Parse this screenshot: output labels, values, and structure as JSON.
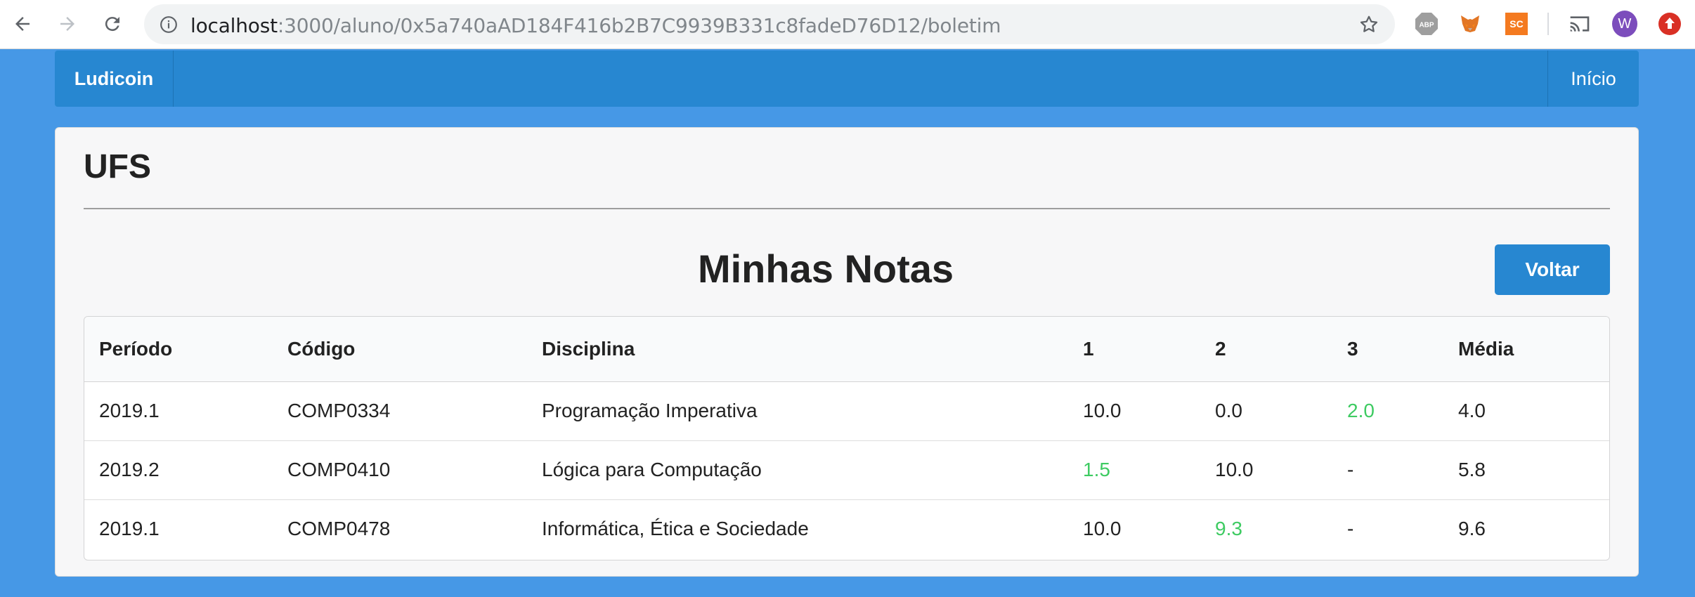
{
  "browser": {
    "url_host": "localhost",
    "url_rest": ":3000/aluno/0x5a740aAD184F416b2B7C9939B331c8fadeD76D12/boletim",
    "extensions": [
      {
        "name": "adblock",
        "label": "ABP"
      },
      {
        "name": "metamask",
        "label": ""
      },
      {
        "name": "sc",
        "label": "SC"
      },
      {
        "name": "cast",
        "label": ""
      },
      {
        "name": "profile",
        "label": "W"
      },
      {
        "name": "update",
        "label": ""
      }
    ]
  },
  "navbar": {
    "brand": "Ludicoin",
    "link": "Início"
  },
  "card": {
    "title": "UFS",
    "section_title": "Minhas Notas",
    "back_button": "Voltar"
  },
  "table": {
    "headers": [
      "Período",
      "Código",
      "Disciplina",
      "1",
      "2",
      "3",
      "Média"
    ],
    "rows": [
      {
        "periodo": "2019.1",
        "codigo": "COMP0334",
        "disciplina": "Programação Imperativa",
        "n1": "10.0",
        "n2": "0.0",
        "n3": "2.0",
        "media": "4.0",
        "highlight": "n3"
      },
      {
        "periodo": "2019.2",
        "codigo": "COMP0410",
        "disciplina": "Lógica para Computação",
        "n1": "1.5",
        "n2": "10.0",
        "n3": "-",
        "media": "5.8",
        "highlight": "n1"
      },
      {
        "periodo": "2019.1",
        "codigo": "COMP0478",
        "disciplina": "Informática, Ética e Sociedade",
        "n1": "10.0",
        "n2": "9.3",
        "n3": "-",
        "media": "9.6",
        "highlight": "n2"
      }
    ]
  },
  "colors": {
    "background": "#4698e6",
    "primary": "#2787d1",
    "highlight_grade": "#3ecb62"
  }
}
